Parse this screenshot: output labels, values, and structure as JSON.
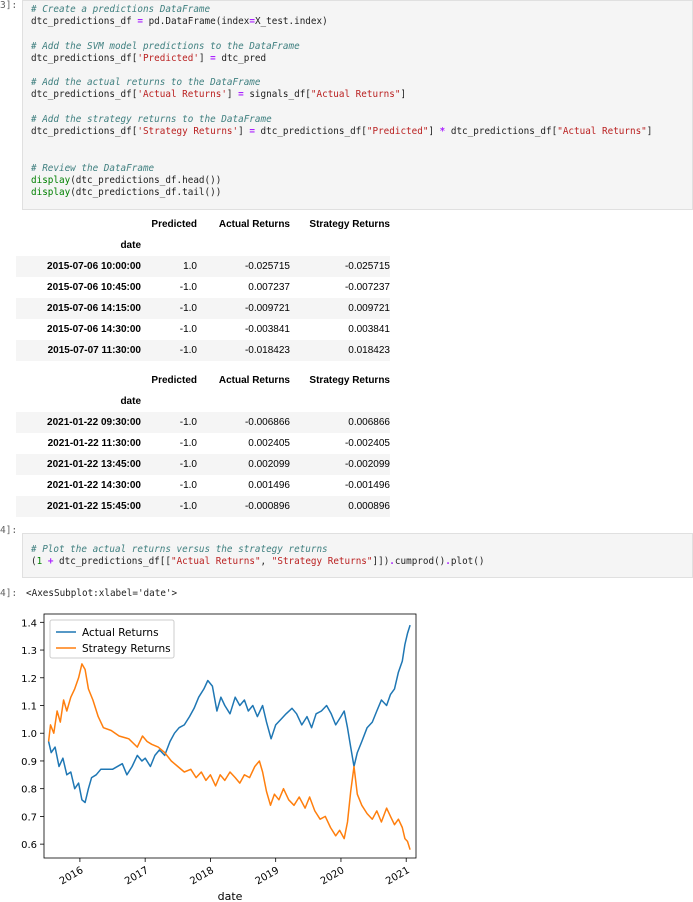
{
  "cell1": {
    "prompt": "3]:",
    "code_lines": [
      [
        {
          "t": "# Create a predictions DataFrame",
          "c": "cm"
        }
      ],
      [
        {
          "t": "dtc_predictions_df "
        },
        {
          "t": "=",
          "c": "op"
        },
        {
          "t": " pd.DataFrame(index"
        },
        {
          "t": "=",
          "c": "op"
        },
        {
          "t": "X_test.index)"
        }
      ],
      [
        {
          "t": ""
        }
      ],
      [
        {
          "t": "# Add the SVM model predictions to the DataFrame",
          "c": "cm"
        }
      ],
      [
        {
          "t": "dtc_predictions_df["
        },
        {
          "t": "'Predicted'",
          "c": "str"
        },
        {
          "t": "] "
        },
        {
          "t": "=",
          "c": "op"
        },
        {
          "t": " dtc_pred"
        }
      ],
      [
        {
          "t": ""
        }
      ],
      [
        {
          "t": "# Add the actual returns to the DataFrame",
          "c": "cm"
        }
      ],
      [
        {
          "t": "dtc_predictions_df["
        },
        {
          "t": "'Actual Returns'",
          "c": "str"
        },
        {
          "t": "] "
        },
        {
          "t": "=",
          "c": "op"
        },
        {
          "t": " signals_df["
        },
        {
          "t": "\"Actual Returns\"",
          "c": "str"
        },
        {
          "t": "]"
        }
      ],
      [
        {
          "t": ""
        }
      ],
      [
        {
          "t": "# Add the strategy returns to the DataFrame",
          "c": "cm"
        }
      ],
      [
        {
          "t": "dtc_predictions_df["
        },
        {
          "t": "'Strategy Returns'",
          "c": "str"
        },
        {
          "t": "] "
        },
        {
          "t": "=",
          "c": "op"
        },
        {
          "t": " dtc_predictions_df["
        },
        {
          "t": "\"Predicted\"",
          "c": "str"
        },
        {
          "t": "] "
        },
        {
          "t": "*",
          "c": "op"
        },
        {
          "t": " dtc_predictions_df["
        },
        {
          "t": "\"Actual Returns\"",
          "c": "str"
        },
        {
          "t": "]"
        }
      ],
      [
        {
          "t": ""
        }
      ],
      [
        {
          "t": ""
        }
      ],
      [
        {
          "t": "# Review the DataFrame",
          "c": "cm"
        }
      ],
      [
        {
          "t": "display",
          "c": "nb"
        },
        {
          "t": "(dtc_predictions_df.head())"
        }
      ],
      [
        {
          "t": "display",
          "c": "nb"
        },
        {
          "t": "(dtc_predictions_df.tail())"
        }
      ]
    ]
  },
  "table_columns": [
    "Predicted",
    "Actual Returns",
    "Strategy Returns"
  ],
  "index_name": "date",
  "head_table": [
    {
      "date": "2015-07-06 10:00:00",
      "predicted": "1.0",
      "actual": "-0.025715",
      "strategy": "-0.025715"
    },
    {
      "date": "2015-07-06 10:45:00",
      "predicted": "-1.0",
      "actual": "0.007237",
      "strategy": "-0.007237"
    },
    {
      "date": "2015-07-06 14:15:00",
      "predicted": "-1.0",
      "actual": "-0.009721",
      "strategy": "0.009721"
    },
    {
      "date": "2015-07-06 14:30:00",
      "predicted": "-1.0",
      "actual": "-0.003841",
      "strategy": "0.003841"
    },
    {
      "date": "2015-07-07 11:30:00",
      "predicted": "-1.0",
      "actual": "-0.018423",
      "strategy": "0.018423"
    }
  ],
  "tail_table": [
    {
      "date": "2021-01-22 09:30:00",
      "predicted": "-1.0",
      "actual": "-0.006866",
      "strategy": "0.006866"
    },
    {
      "date": "2021-01-22 11:30:00",
      "predicted": "-1.0",
      "actual": "0.002405",
      "strategy": "-0.002405"
    },
    {
      "date": "2021-01-22 13:45:00",
      "predicted": "-1.0",
      "actual": "0.002099",
      "strategy": "-0.002099"
    },
    {
      "date": "2021-01-22 14:30:00",
      "predicted": "-1.0",
      "actual": "0.001496",
      "strategy": "-0.001496"
    },
    {
      "date": "2021-01-22 15:45:00",
      "predicted": "-1.0",
      "actual": "-0.000896",
      "strategy": "0.000896"
    }
  ],
  "cell2": {
    "prompt": "4]:",
    "code_lines": [
      [
        {
          "t": "# Plot the actual returns versus the strategy returns",
          "c": "cm"
        }
      ],
      [
        {
          "t": "("
        },
        {
          "t": "1",
          "c": "num"
        },
        {
          "t": " "
        },
        {
          "t": "+",
          "c": "op"
        },
        {
          "t": " dtc_predictions_df[["
        },
        {
          "t": "\"Actual Returns\"",
          "c": "str"
        },
        {
          "t": ", "
        },
        {
          "t": "\"Strategy Returns\"",
          "c": "str"
        },
        {
          "t": "]])"
        },
        {
          "t": ".",
          "c": "op"
        },
        {
          "t": "cumprod()"
        },
        {
          "t": ".",
          "c": "op"
        },
        {
          "t": "plot()"
        }
      ]
    ]
  },
  "output": {
    "prompt": "4]:",
    "text": "<AxesSubplot:xlabel='date'>"
  },
  "chart_data": {
    "type": "line",
    "xlabel": "date",
    "ylabel": "",
    "xlim": [
      2015.45,
      2021.15
    ],
    "ylim": [
      0.55,
      1.43
    ],
    "yticks": [
      0.6,
      0.7,
      0.8,
      0.9,
      1.0,
      1.1,
      1.2,
      1.3,
      1.4
    ],
    "ytick_labels": [
      "0.6",
      "0.7",
      "0.8",
      "0.9",
      "1.0",
      "1.1",
      "1.2",
      "1.3",
      "1.4"
    ],
    "xticks": [
      2016,
      2017,
      2018,
      2019,
      2020,
      2021
    ],
    "xtick_labels": [
      "2016",
      "2017",
      "2018",
      "2019",
      "2020",
      "2021"
    ],
    "legend_position": "top-left",
    "grid": false,
    "series": [
      {
        "name": "Actual Returns",
        "color": "#1f77b4",
        "points": [
          [
            2015.52,
            0.97
          ],
          [
            2015.56,
            0.93
          ],
          [
            2015.62,
            0.95
          ],
          [
            2015.68,
            0.88
          ],
          [
            2015.74,
            0.91
          ],
          [
            2015.8,
            0.85
          ],
          [
            2015.86,
            0.86
          ],
          [
            2015.92,
            0.8
          ],
          [
            2015.98,
            0.82
          ],
          [
            2016.03,
            0.76
          ],
          [
            2016.08,
            0.75
          ],
          [
            2016.13,
            0.8
          ],
          [
            2016.18,
            0.84
          ],
          [
            2016.25,
            0.85
          ],
          [
            2016.32,
            0.87
          ],
          [
            2016.5,
            0.87
          ],
          [
            2016.65,
            0.89
          ],
          [
            2016.72,
            0.85
          ],
          [
            2016.8,
            0.88
          ],
          [
            2016.88,
            0.92
          ],
          [
            2016.95,
            0.9
          ],
          [
            2017.0,
            0.91
          ],
          [
            2017.08,
            0.88
          ],
          [
            2017.15,
            0.92
          ],
          [
            2017.22,
            0.94
          ],
          [
            2017.3,
            0.92
          ],
          [
            2017.38,
            0.97
          ],
          [
            2017.45,
            1.0
          ],
          [
            2017.52,
            1.02
          ],
          [
            2017.6,
            1.03
          ],
          [
            2017.68,
            1.06
          ],
          [
            2017.75,
            1.09
          ],
          [
            2017.82,
            1.13
          ],
          [
            2017.9,
            1.16
          ],
          [
            2017.96,
            1.19
          ],
          [
            2018.03,
            1.17
          ],
          [
            2018.1,
            1.08
          ],
          [
            2018.16,
            1.13
          ],
          [
            2018.22,
            1.1
          ],
          [
            2018.3,
            1.07
          ],
          [
            2018.38,
            1.13
          ],
          [
            2018.45,
            1.1
          ],
          [
            2018.52,
            1.12
          ],
          [
            2018.58,
            1.08
          ],
          [
            2018.65,
            1.1
          ],
          [
            2018.72,
            1.06
          ],
          [
            2018.8,
            1.1
          ],
          [
            2018.86,
            1.04
          ],
          [
            2018.93,
            0.98
          ],
          [
            2019.0,
            1.03
          ],
          [
            2019.08,
            1.05
          ],
          [
            2019.16,
            1.07
          ],
          [
            2019.25,
            1.09
          ],
          [
            2019.32,
            1.07
          ],
          [
            2019.4,
            1.03
          ],
          [
            2019.48,
            1.06
          ],
          [
            2019.55,
            1.02
          ],
          [
            2019.62,
            1.07
          ],
          [
            2019.7,
            1.08
          ],
          [
            2019.78,
            1.1
          ],
          [
            2019.85,
            1.07
          ],
          [
            2019.92,
            1.03
          ],
          [
            2020.0,
            1.06
          ],
          [
            2020.05,
            1.08
          ],
          [
            2020.1,
            1.02
          ],
          [
            2020.15,
            0.95
          ],
          [
            2020.2,
            0.88
          ],
          [
            2020.25,
            0.93
          ],
          [
            2020.32,
            0.97
          ],
          [
            2020.4,
            1.02
          ],
          [
            2020.48,
            1.04
          ],
          [
            2020.55,
            1.08
          ],
          [
            2020.62,
            1.12
          ],
          [
            2020.7,
            1.1
          ],
          [
            2020.76,
            1.14
          ],
          [
            2020.82,
            1.16
          ],
          [
            2020.88,
            1.22
          ],
          [
            2020.94,
            1.26
          ],
          [
            2020.98,
            1.32
          ],
          [
            2021.02,
            1.36
          ],
          [
            2021.06,
            1.39
          ]
        ]
      },
      {
        "name": "Strategy Returns",
        "color": "#ff7f0e",
        "points": [
          [
            2015.52,
            0.97
          ],
          [
            2015.55,
            1.03
          ],
          [
            2015.6,
            1.0
          ],
          [
            2015.65,
            1.08
          ],
          [
            2015.7,
            1.04
          ],
          [
            2015.75,
            1.12
          ],
          [
            2015.8,
            1.08
          ],
          [
            2015.86,
            1.13
          ],
          [
            2015.92,
            1.16
          ],
          [
            2015.98,
            1.2
          ],
          [
            2016.03,
            1.25
          ],
          [
            2016.08,
            1.23
          ],
          [
            2016.13,
            1.16
          ],
          [
            2016.2,
            1.12
          ],
          [
            2016.28,
            1.06
          ],
          [
            2016.36,
            1.02
          ],
          [
            2016.48,
            1.01
          ],
          [
            2016.6,
            0.99
          ],
          [
            2016.75,
            0.98
          ],
          [
            2016.88,
            0.95
          ],
          [
            2016.96,
            0.99
          ],
          [
            2017.03,
            0.97
          ],
          [
            2017.1,
            0.96
          ],
          [
            2017.2,
            0.95
          ],
          [
            2017.3,
            0.93
          ],
          [
            2017.4,
            0.9
          ],
          [
            2017.5,
            0.88
          ],
          [
            2017.6,
            0.86
          ],
          [
            2017.7,
            0.87
          ],
          [
            2017.78,
            0.84
          ],
          [
            2017.86,
            0.86
          ],
          [
            2017.93,
            0.83
          ],
          [
            2018.0,
            0.85
          ],
          [
            2018.08,
            0.81
          ],
          [
            2018.15,
            0.85
          ],
          [
            2018.22,
            0.83
          ],
          [
            2018.3,
            0.86
          ],
          [
            2018.38,
            0.84
          ],
          [
            2018.45,
            0.82
          ],
          [
            2018.52,
            0.85
          ],
          [
            2018.6,
            0.84
          ],
          [
            2018.68,
            0.88
          ],
          [
            2018.75,
            0.9
          ],
          [
            2018.8,
            0.86
          ],
          [
            2018.86,
            0.79
          ],
          [
            2018.92,
            0.74
          ],
          [
            2018.98,
            0.78
          ],
          [
            2019.05,
            0.76
          ],
          [
            2019.12,
            0.8
          ],
          [
            2019.2,
            0.76
          ],
          [
            2019.28,
            0.74
          ],
          [
            2019.36,
            0.77
          ],
          [
            2019.45,
            0.73
          ],
          [
            2019.52,
            0.77
          ],
          [
            2019.6,
            0.72
          ],
          [
            2019.68,
            0.69
          ],
          [
            2019.76,
            0.7
          ],
          [
            2019.84,
            0.66
          ],
          [
            2019.92,
            0.63
          ],
          [
            2019.98,
            0.65
          ],
          [
            2020.05,
            0.62
          ],
          [
            2020.1,
            0.68
          ],
          [
            2020.15,
            0.79
          ],
          [
            2020.2,
            0.88
          ],
          [
            2020.25,
            0.78
          ],
          [
            2020.32,
            0.74
          ],
          [
            2020.4,
            0.71
          ],
          [
            2020.48,
            0.69
          ],
          [
            2020.55,
            0.72
          ],
          [
            2020.62,
            0.68
          ],
          [
            2020.7,
            0.73
          ],
          [
            2020.76,
            0.7
          ],
          [
            2020.82,
            0.67
          ],
          [
            2020.88,
            0.69
          ],
          [
            2020.94,
            0.66
          ],
          [
            2020.98,
            0.62
          ],
          [
            2021.02,
            0.61
          ],
          [
            2021.06,
            0.58
          ]
        ]
      }
    ]
  }
}
